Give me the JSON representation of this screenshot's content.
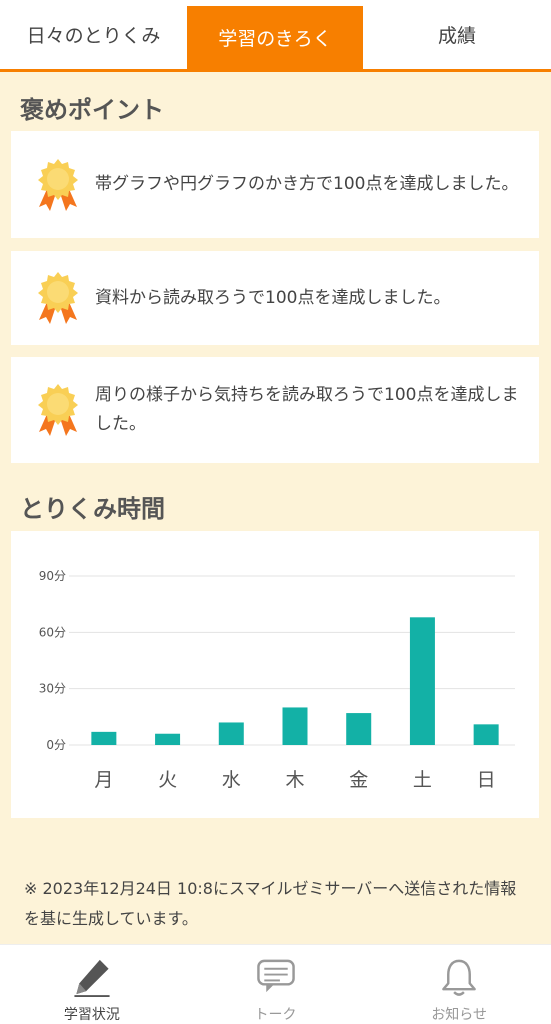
{
  "tabs": [
    {
      "label": "日々のとりくみ"
    },
    {
      "label": "学習のきろく"
    },
    {
      "label": "成績"
    }
  ],
  "praise": {
    "title": "褒めポイント",
    "items": [
      {
        "text": "帯グラフや円グラフのかき方で100点を達成しました。"
      },
      {
        "text": "資料から読み取ろうで100点を達成しました。"
      },
      {
        "text": "周りの様子から気持ちを読み取ろうで100点を達成しました。"
      }
    ]
  },
  "time_section": {
    "title": "とりくみ時間"
  },
  "chart_data": {
    "type": "bar",
    "categories": [
      "月",
      "火",
      "水",
      "木",
      "金",
      "土",
      "日"
    ],
    "values": [
      7,
      6,
      12,
      20,
      17,
      68,
      11
    ],
    "ylim": [
      0,
      90
    ],
    "yticks": [
      "0分",
      "30分",
      "60分",
      "90分"
    ],
    "ytick_values": [
      0,
      30,
      60,
      90
    ],
    "color": "#13b1a6",
    "grid": true
  },
  "note": "※ 2023年12月24日 10:8にスマイルゼミサーバーへ送信された情報を基に生成しています。",
  "bottom_nav": [
    {
      "label": "学習状況",
      "icon": "pencil-icon"
    },
    {
      "label": "トーク",
      "icon": "chat-icon"
    },
    {
      "label": "お知らせ",
      "icon": "bell-icon"
    }
  ],
  "colors": {
    "accent": "#f77f00",
    "bar": "#13b1a6",
    "background": "#fdf3d8"
  }
}
